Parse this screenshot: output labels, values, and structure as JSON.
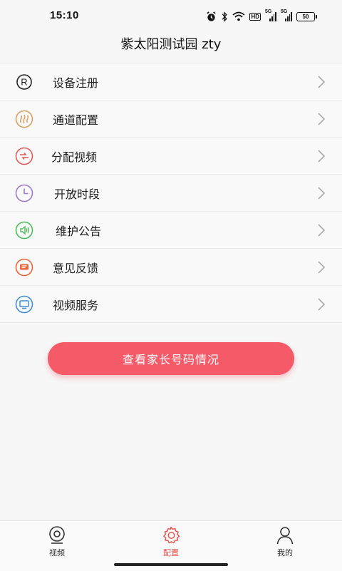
{
  "status_bar": {
    "time": "15:10",
    "hd_label": "HD",
    "sim1_label": "5G",
    "sim2_label": "5G",
    "battery_level": "50",
    "icons": [
      "alarm-icon",
      "bluetooth-icon",
      "wifi-icon",
      "hd-icon",
      "signal-icon",
      "signal-icon",
      "battery-icon"
    ]
  },
  "header": {
    "title": "紫太阳测试园 zty"
  },
  "menu": {
    "items": [
      {
        "label": "设备注册",
        "icon": "registered-icon",
        "color": "#222222"
      },
      {
        "label": "通道配置",
        "icon": "channel-icon",
        "color": "#d9a062"
      },
      {
        "label": "分配视频",
        "icon": "assign-video-icon",
        "color": "#e05a5a"
      },
      {
        "label": "开放时段",
        "icon": "clock-icon",
        "color": "#9b7cc9"
      },
      {
        "label": "维护公告",
        "icon": "speaker-icon",
        "color": "#4cbb5a"
      },
      {
        "label": "意见反馈",
        "icon": "message-icon",
        "color": "#e8643a"
      },
      {
        "label": "视频服务",
        "icon": "monitor-icon",
        "color": "#3f8fd8"
      }
    ]
  },
  "primary_button": {
    "label": "查看家长号码情况",
    "color": "#f45a67"
  },
  "tabbar": {
    "tabs": [
      {
        "label": "视频",
        "icon": "camera-icon",
        "active": false
      },
      {
        "label": "配置",
        "icon": "gear-icon",
        "active": true
      },
      {
        "label": "我的",
        "icon": "user-icon",
        "active": false
      }
    ],
    "active_color": "#e8524f"
  }
}
